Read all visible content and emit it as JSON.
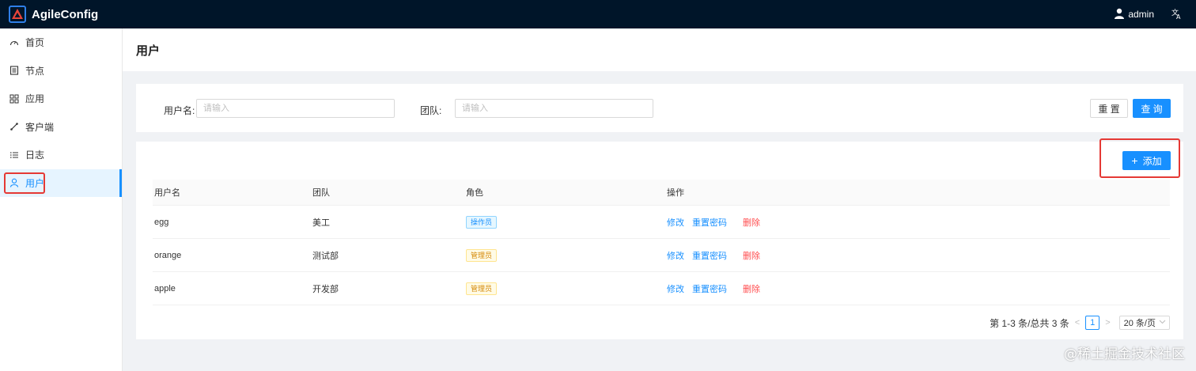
{
  "app": {
    "name": "AgileConfig",
    "user": "admin",
    "translate_icon": "translate-icon",
    "user_icon": "user-icon"
  },
  "sidebar": {
    "items": [
      {
        "label": "首页",
        "icon": "dashboard-icon"
      },
      {
        "label": "节点",
        "icon": "node-list-icon"
      },
      {
        "label": "应用",
        "icon": "apps-grid-icon"
      },
      {
        "label": "客户端",
        "icon": "client-link-icon"
      },
      {
        "label": "日志",
        "icon": "log-list-icon"
      },
      {
        "label": "用户",
        "icon": "user-outline-icon",
        "active": true
      }
    ]
  },
  "page": {
    "title": "用户"
  },
  "search": {
    "username_label": "用户名:",
    "username_placeholder": "请输入",
    "team_label": "团队:",
    "team_placeholder": "请输入",
    "reset_label": "重 置",
    "query_label": "查 询"
  },
  "table": {
    "add_label": "添加",
    "add_icon": "plus-icon",
    "columns": [
      "用户名",
      "团队",
      "角色",
      "操作"
    ],
    "rows": [
      {
        "username": "egg",
        "team": "美工",
        "role": "操作员",
        "role_color": "blue"
      },
      {
        "username": "orange",
        "team": "测试部",
        "role": "管理员",
        "role_color": "gold"
      },
      {
        "username": "apple",
        "team": "开发部",
        "role": "管理员",
        "role_color": "gold"
      }
    ],
    "actions": {
      "edit": "修改",
      "reset_password": "重置密码",
      "delete": "删除"
    }
  },
  "pagination": {
    "summary": "第 1-3 条/总共 3 条",
    "current_page": "1",
    "page_size": "20 条/页"
  },
  "watermark": "@稀土掘金技术社区",
  "colors": {
    "topbar": "#001529",
    "primary": "#1890ff",
    "danger": "#ff4d4f",
    "highlight_box": "#e53935"
  }
}
